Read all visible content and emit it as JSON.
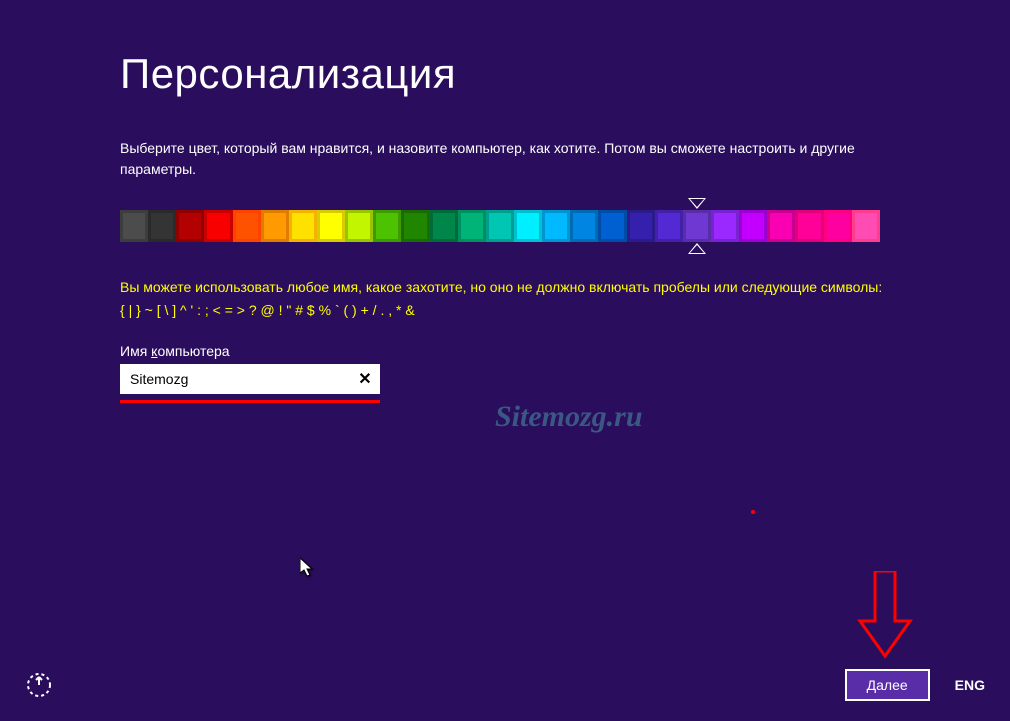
{
  "page_title": "Персонализация",
  "description": "Выберите цвет, который вам нравится, и назовите компьютер, как хотите. Потом вы сможете настроить и другие параметры.",
  "colors": [
    "#3d3d3d",
    "#2a2a2a",
    "#8f0000",
    "#c70000",
    "#ff4200",
    "#e07c00",
    "#f2b400",
    "#d8cc00",
    "#9bc400",
    "#3d9b00",
    "#1a6b00",
    "#006b3a",
    "#008f5e",
    "#009e8f",
    "#00bfd1",
    "#0094d1",
    "#006bb5",
    "#004da8",
    "#2a1a8a",
    "#4221a8",
    "#5a2da8",
    "#7a21d1",
    "#9c00d1",
    "#c7008f",
    "#e0007a",
    "#ff0080",
    "#ff3d8f"
  ],
  "selected_color_index": 20,
  "validation": {
    "text": "Вы можете использовать любое имя, какое захотите, но оно не должно включать пробелы или следующие символы:",
    "chars": "{ | } ~ [ \\ ] ^ ' : ; < = > ? @ ! \" # $ % ` ( ) + / . , * &"
  },
  "input": {
    "label_prefix": "Имя ",
    "label_underline": "к",
    "label_suffix": "омпьютера",
    "value": "Sitemozg"
  },
  "watermark": "Sitemozg.ru",
  "next_button": "Далее",
  "language": "ENG"
}
